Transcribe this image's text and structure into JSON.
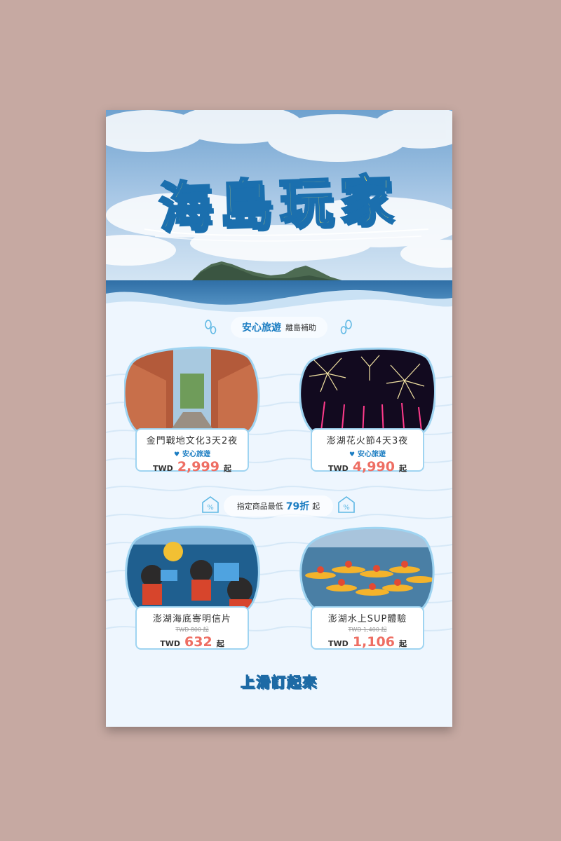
{
  "poster": {
    "title": "海島玩家",
    "safe_pill": {
      "strong": "安心旅遊",
      "light": "離島補助"
    },
    "discount_pill": {
      "prefix": "指定商品最低",
      "percent": "79折",
      "suffix": "起"
    },
    "cta": "上滑訂起來"
  },
  "deals": [
    {
      "title": "金門戰地文化3天2夜",
      "tag": "安心旅遊",
      "currency": "TWD",
      "price": "2,999",
      "suffix": "起"
    },
    {
      "title": "澎湖花火節4天3夜",
      "tag": "安心旅遊",
      "currency": "TWD",
      "price": "4,990",
      "suffix": "起"
    },
    {
      "title": "澎湖海底寄明信片",
      "old_price": "TWD 800 起",
      "currency": "TWD",
      "price": "632",
      "suffix": "起"
    },
    {
      "title": "澎湖水上SUP體驗",
      "old_price": "TWD 1,400 起",
      "currency": "TWD",
      "price": "1,106",
      "suffix": "起"
    }
  ],
  "icons": [
    "footprint-icon",
    "heart-icon",
    "percent-tag-icon"
  ],
  "colors": {
    "accent": "#1b7dc2",
    "price": "#ee6e63",
    "title_fill": "#f6e25c",
    "background": "#c6a9a2"
  }
}
